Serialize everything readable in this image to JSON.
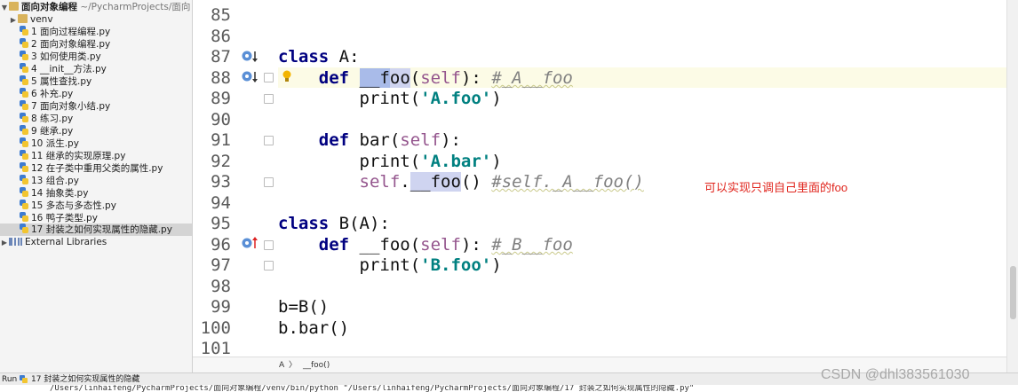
{
  "project_tree": {
    "root_name": "面向对象编程",
    "root_path": "~/PycharmProjects/面向",
    "venv": "venv",
    "files": [
      "1 面向过程编程.py",
      "2 面向对象编程.py",
      "3 如何使用类.py",
      "4 __init__方法.py",
      "5 属性查找.py",
      "6 补充.py",
      "7 面向对象小结.py",
      "8 练习.py",
      "9 继承.py",
      "10 派生.py",
      "11 继承的实现原理.py",
      "12 在子类中重用父类的属性.py",
      "13 组合.py",
      "14 抽象类.py",
      "15 多态与多态性.py",
      "16 鸭子类型.py",
      "17 封装之如何实现属性的隐藏.py"
    ],
    "external_libraries": "External Libraries"
  },
  "editor": {
    "line_numbers": [
      "85",
      "86",
      "87",
      "88",
      "89",
      "90",
      "91",
      "92",
      "93",
      "94",
      "95",
      "96",
      "97",
      "98",
      "99",
      "100",
      "101"
    ],
    "annotation": "可以实现只调自己里面的foo"
  },
  "breadcrumb": {
    "class_name": "A",
    "separator": "〉",
    "method_name": "__foo()"
  },
  "run_bar": {
    "label": "Run",
    "tab_name": "17 封装之如何实现属性的隐藏"
  },
  "run_output": "/Users/linhaifeng/PycharmProjects/面向对象编程/venv/bin/python \"/Users/linhaifeng/PycharmProjects/面向对象编程/17 封装之如何实现属性的隐藏.py\"",
  "watermark": "CSDN @dhl383561030",
  "colors": {
    "keyword": "#000080",
    "self": "#94558d",
    "string": "#008080",
    "comment": "#808080",
    "annotation": "#e0241c"
  }
}
